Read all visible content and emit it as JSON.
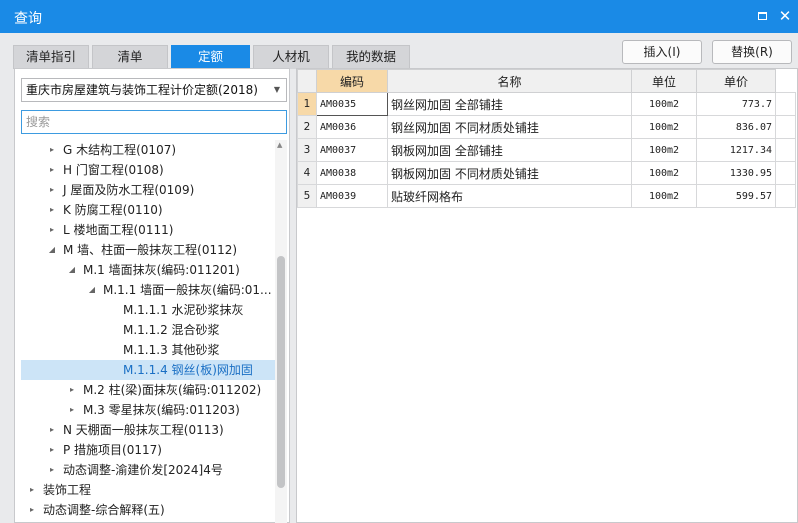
{
  "window": {
    "title": "查询"
  },
  "tabs": [
    {
      "label": "清单指引",
      "active": false
    },
    {
      "label": "清单",
      "active": false
    },
    {
      "label": "定额",
      "active": true
    },
    {
      "label": "人材机",
      "active": false
    },
    {
      "label": "我的数据",
      "active": false
    }
  ],
  "actions": {
    "insert_label": "插入(I)",
    "replace_label": "替换(R)"
  },
  "left": {
    "library_select": "重庆市房屋建筑与装饰工程计价定额(2018)",
    "search_placeholder": "搜索"
  },
  "tree": [
    {
      "label": "G 木结构工程(0107)",
      "arrow": "▸"
    },
    {
      "label": "H 门窗工程(0108)",
      "arrow": "▸"
    },
    {
      "label": "J 屋面及防水工程(0109)",
      "arrow": "▸"
    },
    {
      "label": "K 防腐工程(0110)",
      "arrow": "▸"
    },
    {
      "label": "L 楼地面工程(0111)",
      "arrow": "▸"
    },
    {
      "label": "M 墙、柱面一般抹灰工程(0112)",
      "arrow": "◢"
    },
    {
      "label": "M.1 墙面抹灰(编码:011201)",
      "arrow": "◢"
    },
    {
      "label": "M.1.1 墙面一般抹灰(编码:01...",
      "arrow": "◢"
    },
    {
      "label": "M.1.1.1 水泥砂浆抹灰",
      "arrow": ""
    },
    {
      "label": "M.1.1.2 混合砂浆",
      "arrow": ""
    },
    {
      "label": "M.1.1.3 其他砂浆",
      "arrow": ""
    },
    {
      "label": "M.1.1.4 钢丝(板)网加固",
      "arrow": "",
      "selected": true
    },
    {
      "label": "M.2 柱(梁)面抹灰(编码:011202)",
      "arrow": "▸"
    },
    {
      "label": "M.3 零星抹灰(编码:011203)",
      "arrow": "▸"
    },
    {
      "label": "N 天棚面一般抹灰工程(0113)",
      "arrow": "▸"
    },
    {
      "label": "P 措施项目(0117)",
      "arrow": "▸"
    },
    {
      "label": "动态调整-渝建价发[2024]4号",
      "arrow": "▸"
    },
    {
      "label": "装饰工程",
      "arrow": "▸"
    },
    {
      "label": "动态调整-综合解释(五)",
      "arrow": "▸"
    }
  ],
  "table": {
    "headers": {
      "code": "编码",
      "name": "名称",
      "unit": "单位",
      "price": "单价"
    },
    "rows": [
      {
        "num": "1",
        "code": "AM0035",
        "name": "钢丝网加固 全部铺挂",
        "unit": "100m2",
        "price": "773.7"
      },
      {
        "num": "2",
        "code": "AM0036",
        "name": "钢丝网加固 不同材质处铺挂",
        "unit": "100m2",
        "price": "836.07"
      },
      {
        "num": "3",
        "code": "AM0037",
        "name": "钢板网加固 全部铺挂",
        "unit": "100m2",
        "price": "1217.34"
      },
      {
        "num": "4",
        "code": "AM0038",
        "name": "钢板网加固 不同材质处铺挂",
        "unit": "100m2",
        "price": "1330.95"
      },
      {
        "num": "5",
        "code": "AM0039",
        "name": "贴玻纤网格布",
        "unit": "100m2",
        "price": "599.57"
      }
    ]
  },
  "colors": {
    "accent": "#1a8ae6",
    "header_highlight": "#f7d9a8",
    "selection": "#cce4f7"
  }
}
